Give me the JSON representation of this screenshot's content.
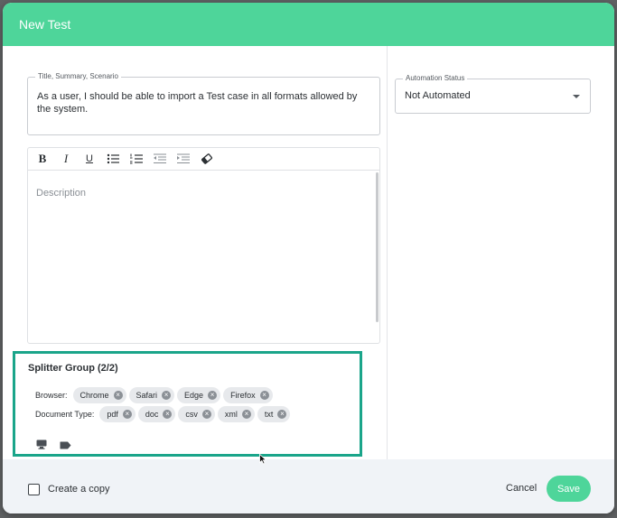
{
  "modal": {
    "title": "New Test"
  },
  "title_field": {
    "label": "Title, Summary, Scenario",
    "value": "As a user, I should be able to import a Test case in all formats allowed by the system."
  },
  "editor": {
    "placeholder": "Description",
    "toolbar": {
      "bold": "B",
      "italic": "I",
      "underline": "U",
      "icons": [
        "bold-icon",
        "italic-icon",
        "underline-icon",
        "bulleted-list-icon",
        "numbered-list-icon",
        "outdent-icon",
        "indent-icon",
        "eraser-icon"
      ]
    }
  },
  "automation": {
    "label": "Automation Status",
    "value": "Not Automated"
  },
  "splitter": {
    "title": "Splitter Group (2/2)",
    "browser_label": "Browser:",
    "browsers": [
      "Chrome",
      "Safari",
      "Edge",
      "Firefox"
    ],
    "doc_label": "Document Type:",
    "doc_types": [
      "pdf",
      "doc",
      "csv",
      "xml",
      "txt"
    ],
    "chip_remove_glyph": "×",
    "bottom_icons": [
      "monitor-icon",
      "tag-icon"
    ]
  },
  "footer": {
    "copy_label": "Create a copy",
    "cancel": "Cancel",
    "save": "Save"
  },
  "colors": {
    "accent": "#4ed59a",
    "splitter_border": "#1aa58a"
  }
}
